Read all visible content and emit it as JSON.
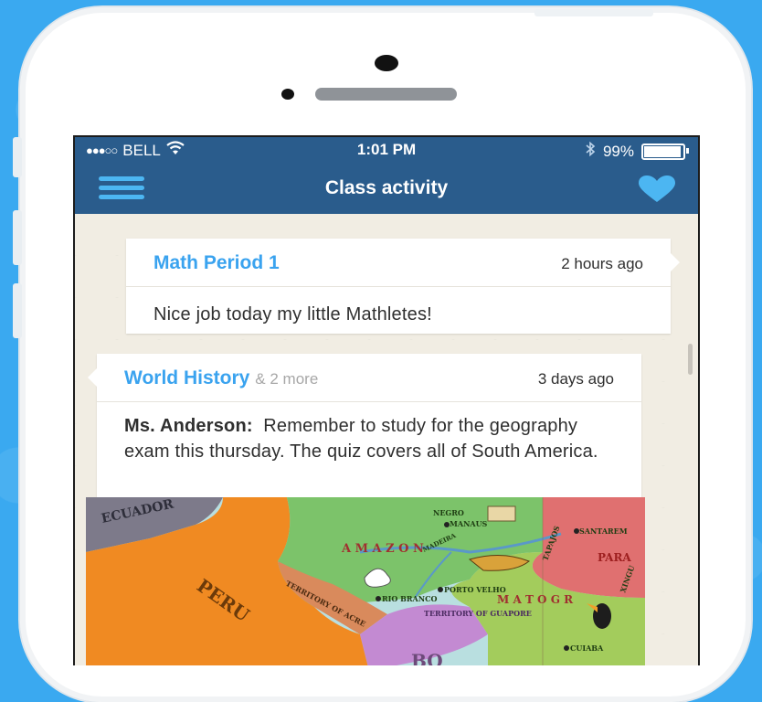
{
  "status_bar": {
    "carrier": "BELL",
    "time": "1:01 PM",
    "battery": "99%",
    "battery_level": 0.99,
    "icons": [
      "signal-dots-icon",
      "wifi-icon",
      "bluetooth-icon",
      "battery-icon"
    ]
  },
  "nav": {
    "title": "Class activity",
    "icons": [
      "menu-icon",
      "heart-icon"
    ]
  },
  "posts": [
    {
      "class": "Math Period 1",
      "more": "",
      "time": "2 hours ago",
      "author": "",
      "message": "Nice job today my little Mathletes!"
    },
    {
      "class": "World History",
      "more": "& 2 more",
      "time": "3 days ago",
      "author": "Ms. Anderson:",
      "message": "Remember to study for the geography exam this thursday.  The quiz covers all of South America."
    }
  ],
  "map": {
    "labels": {
      "ecuador": "ECUADOR",
      "peru": "PERU",
      "negro": "NEGRO",
      "manaus": "MANAUS",
      "santarem": "SANTAREM",
      "tapajos": "TAPAJOS",
      "para": "PARA",
      "xingu": "XINGU",
      "amazonas": "A M A Z O N",
      "madeira": "MADEIRA",
      "porto_velho": "PORTO VELHO",
      "rio_branco": "RIO BRANCO",
      "territory_acre": "TERRITORY OF ACRE",
      "territory_guapore": "TERRITORY OF GUAPORE",
      "mato_grosso": "M A T O G R",
      "cuiaba": "CUIABA",
      "bo": "BO"
    },
    "colors": {
      "water": "#b9dfe0",
      "ecuador": "#7d7a8a",
      "peru": "#f08a22",
      "amazonas": "#7cc36a",
      "acre": "#d98a5c",
      "guapore": "#c38ad2",
      "para": "#e07070",
      "mato_grosso": "#a3cc5c"
    }
  },
  "colors": {
    "brand_blue": "#3aa9f0",
    "nav_blue": "#2a5c8c",
    "link_blue": "#3aa3ef",
    "feed_bg": "#f1ede3"
  }
}
